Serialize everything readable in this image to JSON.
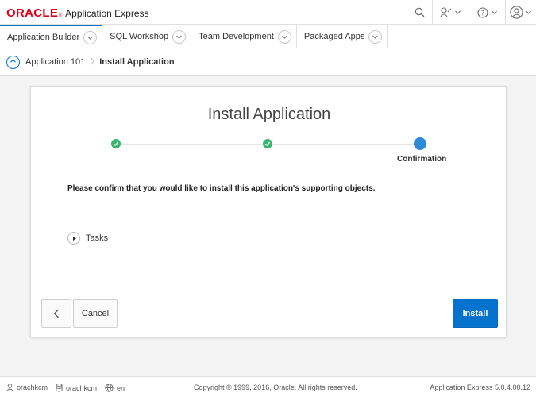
{
  "header": {
    "brand_oracle": "ORACLE",
    "brand_reg": "®",
    "brand_app": "Application Express",
    "icons": [
      "search-icon",
      "developer-icon",
      "help-icon",
      "user-icon"
    ]
  },
  "tabs": [
    {
      "label": "Application Builder",
      "active": true
    },
    {
      "label": "SQL Workshop",
      "active": false
    },
    {
      "label": "Team Development",
      "active": false
    },
    {
      "label": "Packaged Apps",
      "active": false
    }
  ],
  "breadcrumb": {
    "parent": "Application 101",
    "current": "Install Application"
  },
  "dialog": {
    "title": "Install Application",
    "steps": [
      {
        "state": "done",
        "label": ""
      },
      {
        "state": "done",
        "label": ""
      },
      {
        "state": "current",
        "label": "Confirmation"
      }
    ],
    "message": "Please confirm that you would like to install this application's supporting objects.",
    "tasks_label": "Tasks",
    "cancel_label": "Cancel",
    "install_label": "Install"
  },
  "footer": {
    "user1": "orachkcm",
    "user2": "orachkcm",
    "language": "en",
    "copyright": "Copyright © 1999, 2016, Oracle. All rights reserved.",
    "version": "Application Express 5.0.4.00.12"
  },
  "colors": {
    "brand_red": "#e2001a",
    "accent_blue": "#0572ce",
    "step_done": "#35b66b",
    "step_current": "#2f8ad9"
  }
}
